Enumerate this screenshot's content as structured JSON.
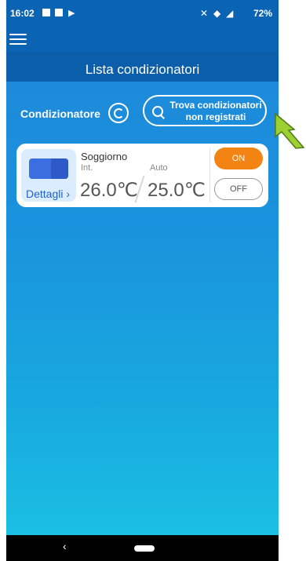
{
  "status": {
    "time": "16:02",
    "battery": "72%"
  },
  "header": {
    "title": "Lista condizionatori"
  },
  "controls": {
    "section_label": "Condizionatore",
    "find_button": "Trova condizionatori non registrati"
  },
  "device": {
    "room": "Soggiorno",
    "int_label": "Int.",
    "mode_label": "Auto",
    "indoor_temp": "26.0℃",
    "set_temp": "25.0℃",
    "details_label": "Dettagli",
    "on_label": "ON",
    "off_label": "OFF"
  },
  "nav": {
    "back": "‹"
  },
  "colors": {
    "accent_orange": "#f38413",
    "header_blue": "#0b63b4",
    "pointer_green": "#9ccf2f"
  }
}
